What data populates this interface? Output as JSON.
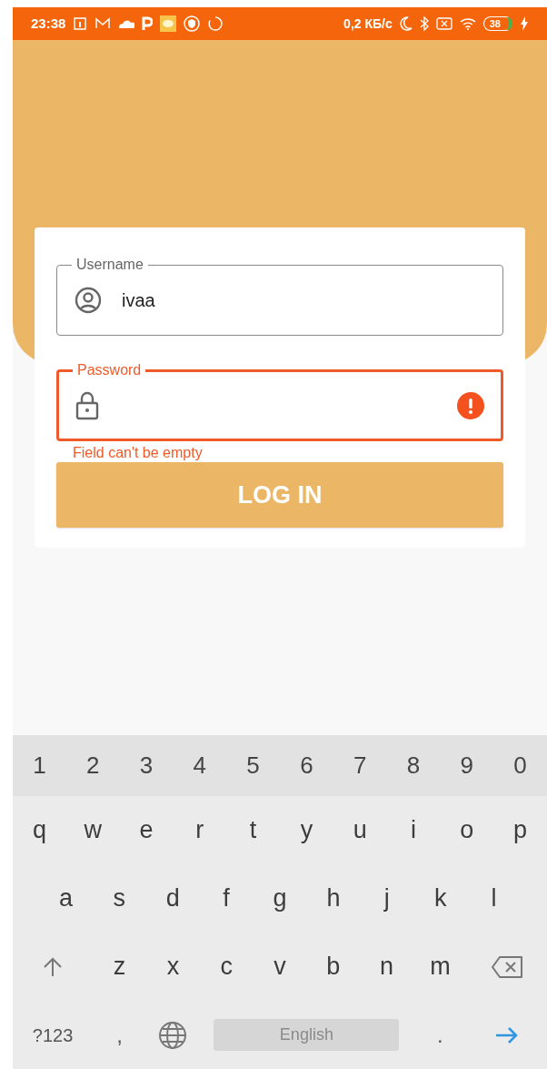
{
  "status_bar": {
    "time": "23:38",
    "speed": "0,2 КБ/с",
    "battery": "38"
  },
  "login_form": {
    "fields": [
      {
        "kind": "username",
        "label": "Username",
        "value": "ivaa",
        "error": false
      },
      {
        "kind": "password",
        "label": "Password",
        "error": true,
        "error_text": "Field can't be empty"
      }
    ],
    "button": "LOG IN"
  },
  "keyboard": {
    "number_row": [
      "1",
      "2",
      "3",
      "4",
      "5",
      "6",
      "7",
      "8",
      "9",
      "0"
    ],
    "letter_rows": [
      [
        "q",
        "w",
        "e",
        "r",
        "t",
        "y",
        "u",
        "i",
        "o",
        "p"
      ],
      [
        "a",
        "s",
        "d",
        "f",
        "g",
        "h",
        "j",
        "k",
        "l"
      ],
      [
        "z",
        "x",
        "c",
        "v",
        "b",
        "n",
        "m"
      ]
    ],
    "symbols_key": "?123",
    "comma_key": ",",
    "space_key": "English",
    "period_key": "."
  }
}
